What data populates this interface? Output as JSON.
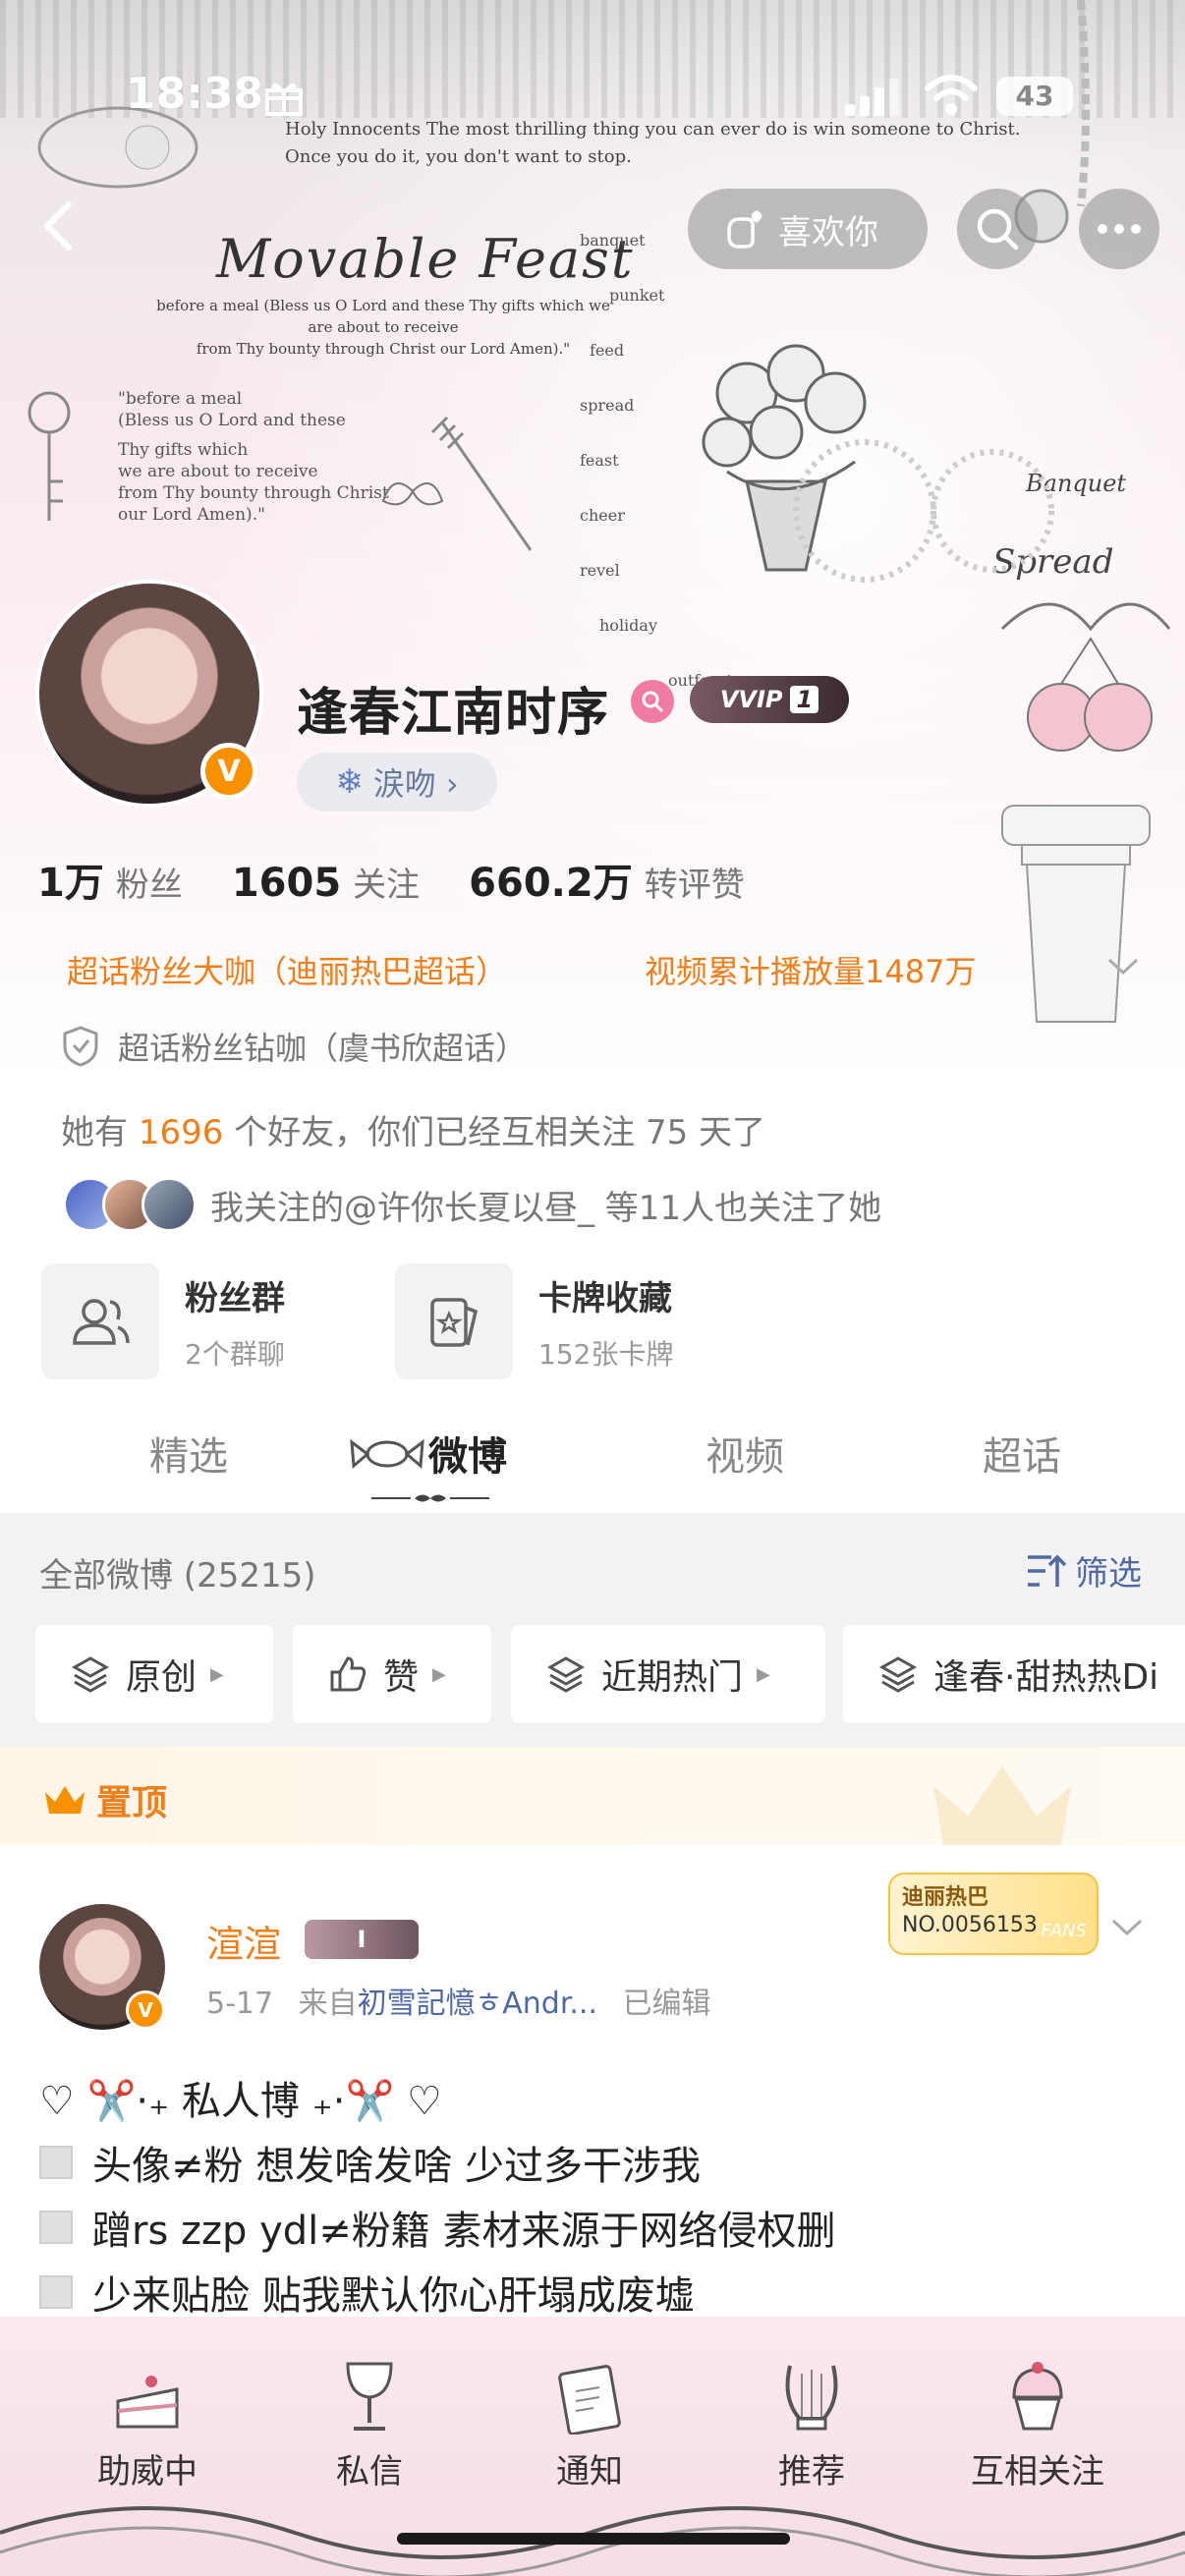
{
  "status_bar": {
    "time": "18:38",
    "battery": "43"
  },
  "header": {
    "like_label": "喜欢你",
    "deco": {
      "poem_top_1": "Holy Innocents The most thrilling thing you can ever do is win someone to Christ.",
      "poem_top_2": "Once you do it, you don't want to stop.",
      "script_title": "Movable Feast",
      "prayer_1": "before a meal (Bless us O Lord and these Thy gifts which we are about to receive",
      "prayer_2": "from Thy bounty through Christ our Lord Amen).\"",
      "poem_side_1": "\"before a meal",
      "poem_side_2": "(Bless us O Lord and these",
      "poem_side_3": "Thy gifts which",
      "poem_side_4": "we are about to receive",
      "poem_side_5": "from Thy bounty through Christ",
      "poem_side_6": "our Lord Amen).\"",
      "words": [
        "banquet",
        "punket",
        "feed",
        "spread",
        "feast",
        "cheer",
        "revel",
        "holiday",
        "outfeast"
      ],
      "banquet": "Banquet",
      "spread": "Spread"
    }
  },
  "profile": {
    "name": "逢春江南时序",
    "vip_label": "VVIP",
    "vip_level": "1",
    "tag_label": "涙吻 ›",
    "stats": [
      {
        "num": "1万",
        "label": "粉丝"
      },
      {
        "num": "1605",
        "label": "关注"
      },
      {
        "num": "660.2万",
        "label": "转评赞"
      }
    ],
    "honor_1": "超话粉丝大咖（迪丽热巴超话）",
    "honor_2": "视频累计播放量1487万",
    "honor_3": "超话粉丝钻咖（虞书欣超话）",
    "friends_pre": "她有 ",
    "friends_count": "1696",
    "friends_post": " 个好友，你们已经互相关注 75 天了",
    "mutual_text": "我关注的@许你长夏以昼_ 等11人也关注了她"
  },
  "cards": [
    {
      "title": "粉丝群",
      "sub": "2个群聊"
    },
    {
      "title": "卡牌收藏",
      "sub": "152张卡牌"
    }
  ],
  "tabs": [
    "精选",
    "微博",
    "视频",
    "超话"
  ],
  "filter": {
    "all_posts": "全部微博 (25215)",
    "filter_label": "筛选",
    "chips": [
      "原创",
      "赞",
      "近期热门",
      "逢春·甜热热Di"
    ]
  },
  "pinned_label": "置顶",
  "post": {
    "author": "渲渲",
    "author_badge": "I",
    "date": "5-17",
    "from_pre": "来自",
    "source": "初雪記憶ㅎAndr...",
    "edited": "已编辑",
    "fans_badge_name": "迪丽热巴",
    "fans_badge_no": "NO.0056153",
    "fans_badge_tag": "FANS",
    "line_1": "♡ ✂️·₊ 私人博 ₊·✂️ ♡",
    "line_2": "头像≠粉 想发啥发啥 少过多干涉我",
    "line_3": "蹭rs zzp ydl≠粉籍 素材来源于网络侵权删",
    "line_4": "少来贴脸 贴我默认你心肝塌成废墟"
  },
  "bottom_nav": [
    "助威中",
    "私信",
    "通知",
    "推荐",
    "互相关注"
  ],
  "colors": {
    "accent": "#ef7f1a",
    "link": "#4f6aa2",
    "vip": "#f79100"
  }
}
